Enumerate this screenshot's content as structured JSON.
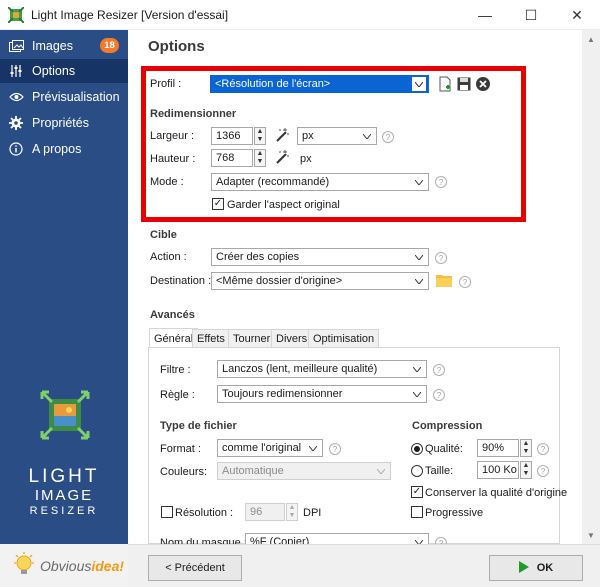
{
  "window": {
    "title": "Light Image Resizer  [Version d'essai]",
    "minimize": "—",
    "maximize": "☐",
    "close": "✕"
  },
  "sidebar": {
    "items": [
      {
        "label": "Images",
        "icon": "images-icon",
        "badge": "18"
      },
      {
        "label": "Options",
        "icon": "options-icon",
        "active": true
      },
      {
        "label": "Prévisualisation",
        "icon": "eye-icon"
      },
      {
        "label": "Propriétés",
        "icon": "gear-icon"
      },
      {
        "label": "A propos",
        "icon": "info-icon"
      }
    ],
    "brand": {
      "line1": "LIGHT",
      "line2": "IMAGE",
      "line3": "RESIZER"
    },
    "company": {
      "part1": "Obvious",
      "part2": "idea!"
    }
  },
  "main": {
    "heading": "Options",
    "profile": {
      "label": "Profil :",
      "value": "<Résolution de l'écran>"
    },
    "resize": {
      "heading": "Redimensionner",
      "width_label": "Largeur :",
      "width_value": "1366",
      "height_label": "Hauteur :",
      "height_value": "768",
      "unit_select": "px",
      "unit_text": "px",
      "mode_label": "Mode :",
      "mode_value": "Adapter (recommandé)",
      "keep_aspect": "Garder l'aspect original"
    },
    "target": {
      "heading": "Cible",
      "action_label": "Action :",
      "action_value": "Créer des copies",
      "dest_label": "Destination :",
      "dest_value": "<Même dossier d'origine>"
    },
    "advanced": {
      "heading": "Avancés",
      "tabs": [
        "Général",
        "Effets",
        "Tourner",
        "Divers",
        "Optimisation"
      ],
      "filter_label": "Filtre :",
      "filter_value": "Lanczos  (lent, meilleure qualité)",
      "rule_label": "Règle :",
      "rule_value": "Toujours redimensionner",
      "filetype_heading": "Type de fichier",
      "format_label": "Format :",
      "format_value": "comme l'original",
      "colors_label": "Couleurs:",
      "colors_value": "Automatique",
      "resolution_label": "Résolution :",
      "resolution_value": "96",
      "resolution_unit": "DPI",
      "mask_label": "Nom du masque :",
      "mask_value": "%F (Copier)",
      "compression_heading": "Compression",
      "quality_label": "Qualité:",
      "quality_value": "90%",
      "size_label": "Taille:",
      "size_value": "100 Ko",
      "keep_quality": "Conserver la qualité d'origine",
      "progressive": "Progressive"
    }
  },
  "footer": {
    "prev": "< Précédent",
    "ok": "OK"
  },
  "colors": {
    "sidebar": "#2a4d86",
    "accent_red": "#ea0000",
    "badge": "#f47a2a",
    "ok_green": "#1f9b2a"
  }
}
